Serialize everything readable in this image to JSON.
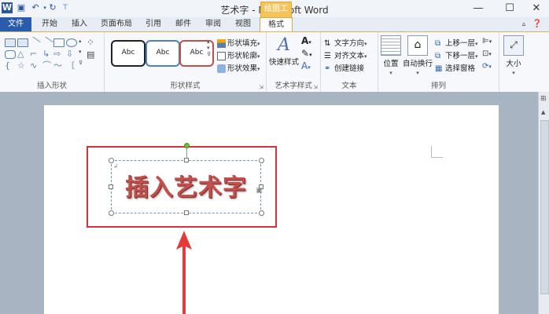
{
  "window": {
    "title": "艺术字 - Microsoft Word",
    "context_tab_group": "绘图工具",
    "min_label": "—",
    "max_label": "☐",
    "close_label": "✕"
  },
  "tabs": [
    {
      "label": "文件"
    },
    {
      "label": "开始"
    },
    {
      "label": "插入"
    },
    {
      "label": "页面布局"
    },
    {
      "label": "引用"
    },
    {
      "label": "邮件"
    },
    {
      "label": "审阅"
    },
    {
      "label": "视图"
    },
    {
      "label": "格式"
    }
  ],
  "ribbon": {
    "groups": {
      "insert_shapes": "插入形状",
      "shape_styles": "形状样式",
      "wordart_styles": "艺术字样式",
      "text": "文本",
      "arrange": "排列"
    },
    "style_samples": [
      "Abc",
      "Abc",
      "Abc"
    ],
    "shape_fill": "形状填充",
    "shape_outline": "形状轮廓",
    "shape_effects": "形状效果",
    "quick_styles": "快速样式",
    "text_direction": "文字方向",
    "align_text": "对齐文本",
    "create_link": "创建链接",
    "position": "位置",
    "wrap_text": "自动换行",
    "bring_forward": "上移一层",
    "send_backward": "下移一层",
    "selection_pane": "选择窗格",
    "size": "大小"
  },
  "document": {
    "wordart_text": "插入艺术字"
  },
  "colors": {
    "accent_red": "#d9303b",
    "wordart_red": "#c0504d",
    "file_tab_blue": "#2a5cac",
    "context_orange": "#f3c45b"
  }
}
